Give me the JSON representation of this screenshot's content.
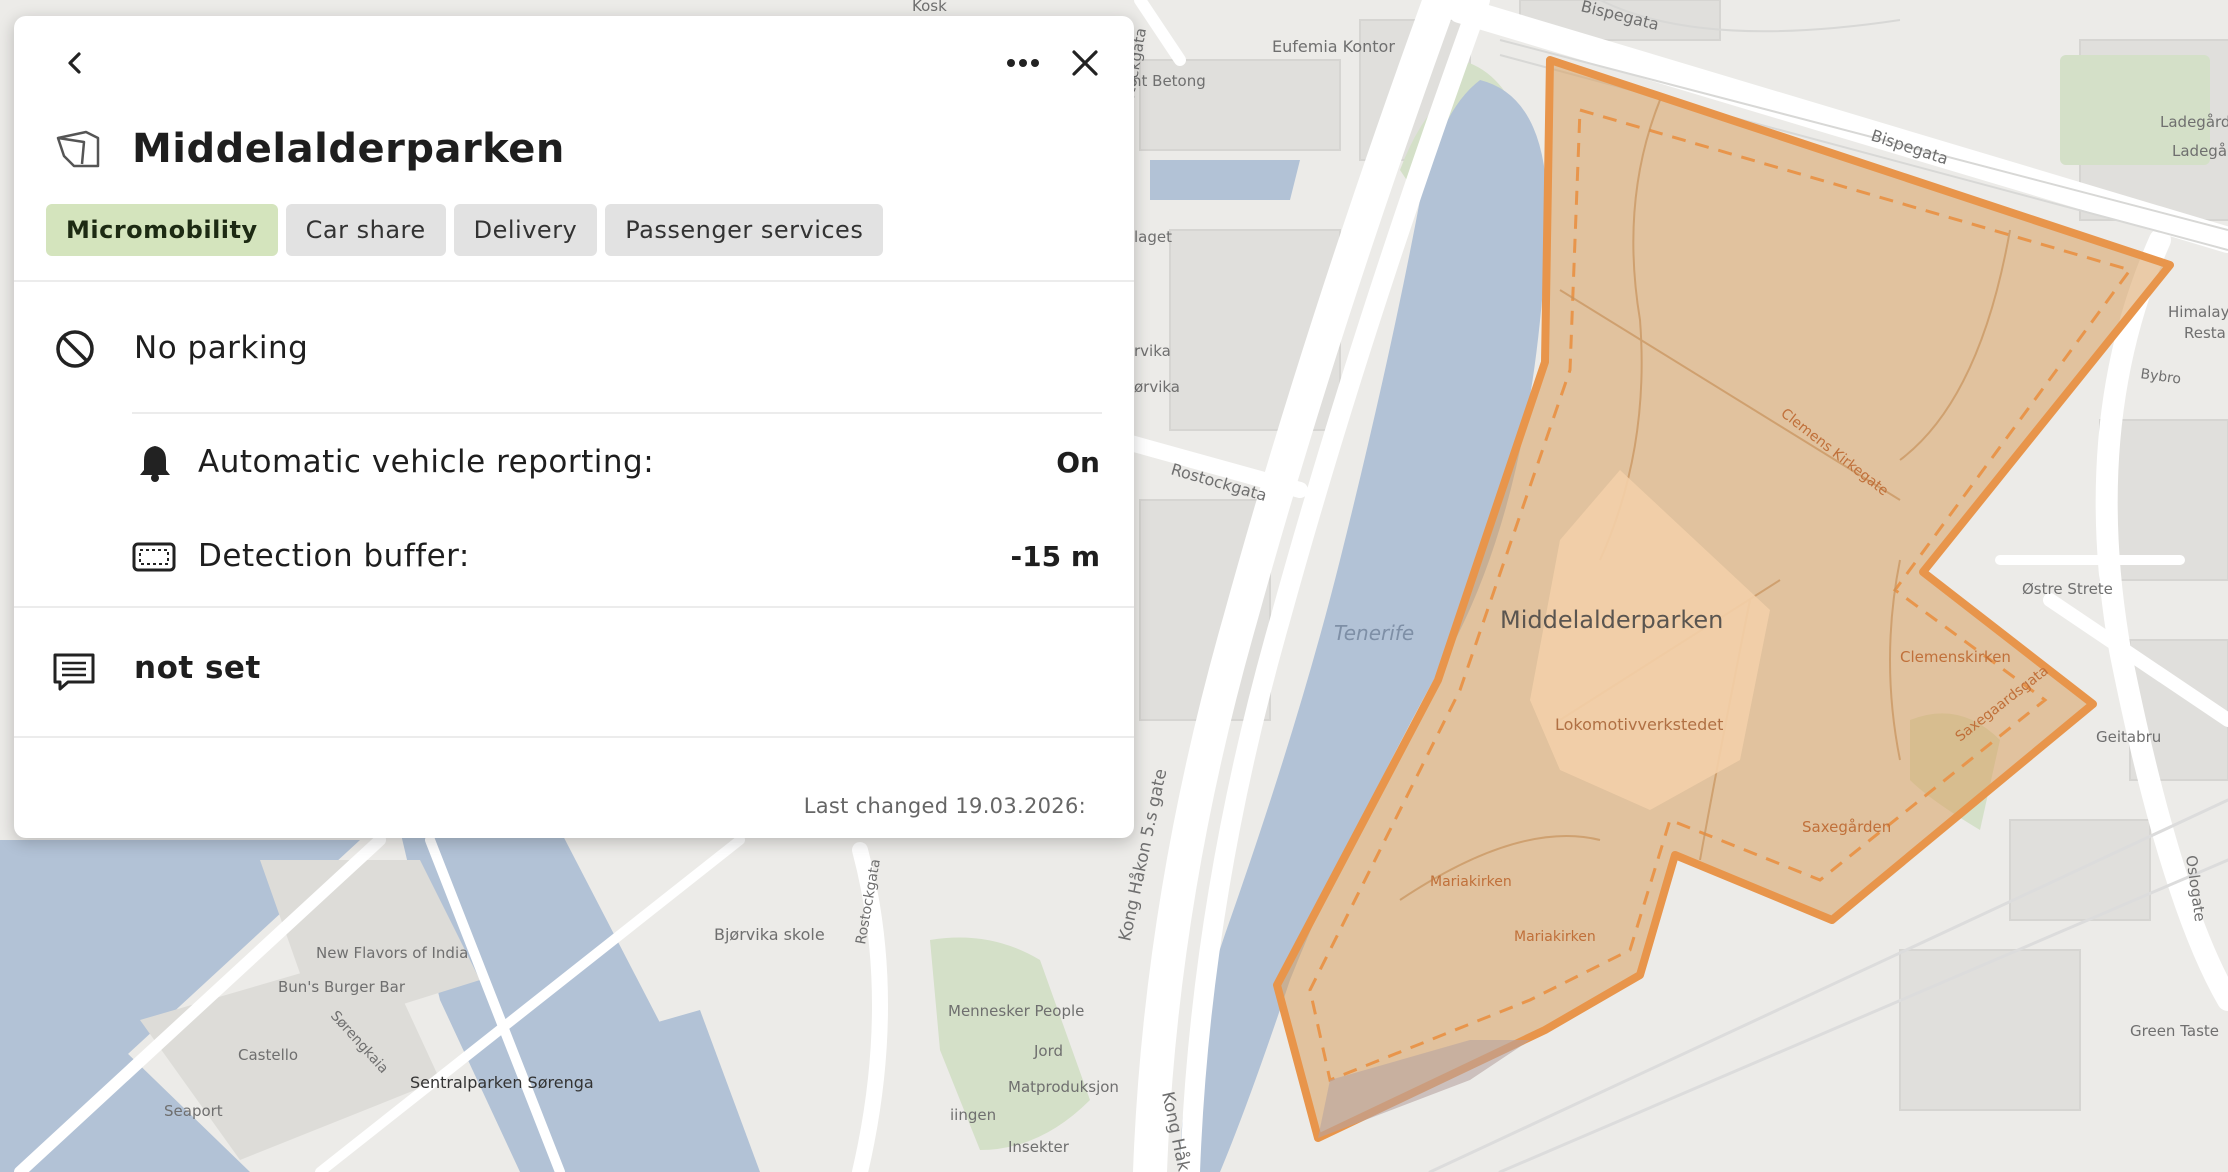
{
  "panel": {
    "title": "Middelalderparken",
    "tags": [
      {
        "label": "Micromobility",
        "active": true
      },
      {
        "label": "Car share",
        "active": false
      },
      {
        "label": "Delivery",
        "active": false
      },
      {
        "label": "Passenger services",
        "active": false
      }
    ],
    "rule": "No parking",
    "settings": [
      {
        "label": "Automatic vehicle reporting:",
        "value": "On",
        "icon": "bell-icon"
      },
      {
        "label": "Detection buffer:",
        "value": "-15 m",
        "icon": "buffer-icon"
      }
    ],
    "note": "not set",
    "last_changed": "Last changed 19.03.2026:"
  },
  "map": {
    "zone_color": "#e8954b",
    "water_color": "#b2c2d6",
    "labels": {
      "kosk": "Kosk",
      "eufemia": "Eufemia Kontor",
      "betong": "nt Betong",
      "bispegata": "Bispegata",
      "bispegata2": "Bispegata",
      "ladegard": "Ladegård",
      "ladeg2": "Ladegå",
      "himalaya": "Himalaya",
      "resta": "Resta",
      "laget": "laget",
      "vika": "rvika",
      "orvika": "ørvika",
      "rostockgata": "Rostockgata",
      "rostockgata2": "Rostockgata",
      "rostockgata3": "Rostockgata",
      "tenerife": "Tenerife",
      "park": "Middelalderparken",
      "clemens": "Clemens Kirkegate",
      "clemenskirken": "Clemenskirken",
      "ostre": "Østre Strete",
      "lokomotiv": "Lokomotivverkstedet",
      "saxegarden": "Saxegården",
      "saxegaarden2": "Saxegaardsgata",
      "geitabru": "Geitabru",
      "oslogate": "Oslogate",
      "mariakirken": "Mariakirken",
      "mariakirken2": "Mariakirken",
      "konghakon": "Kong Håkon 5.s gate",
      "konghakon2": "Kong Håk",
      "bjorvika": "Bjørvika skole",
      "flavors": "New Flavors of India",
      "buns": "Bun's Burger Bar",
      "sorengkaia": "Sørengkaia",
      "castello": "Castello",
      "seaport": "Seaport",
      "sentralparken": "Sentralparken Sørenga",
      "mennesker": "Mennesker People",
      "jord": "Jord",
      "matproduksjon": "Matproduksjon",
      "ingen": "iingen",
      "insekter": "Insekter",
      "greentaste": "Green Taste",
      "bybro": "Bybro"
    }
  }
}
